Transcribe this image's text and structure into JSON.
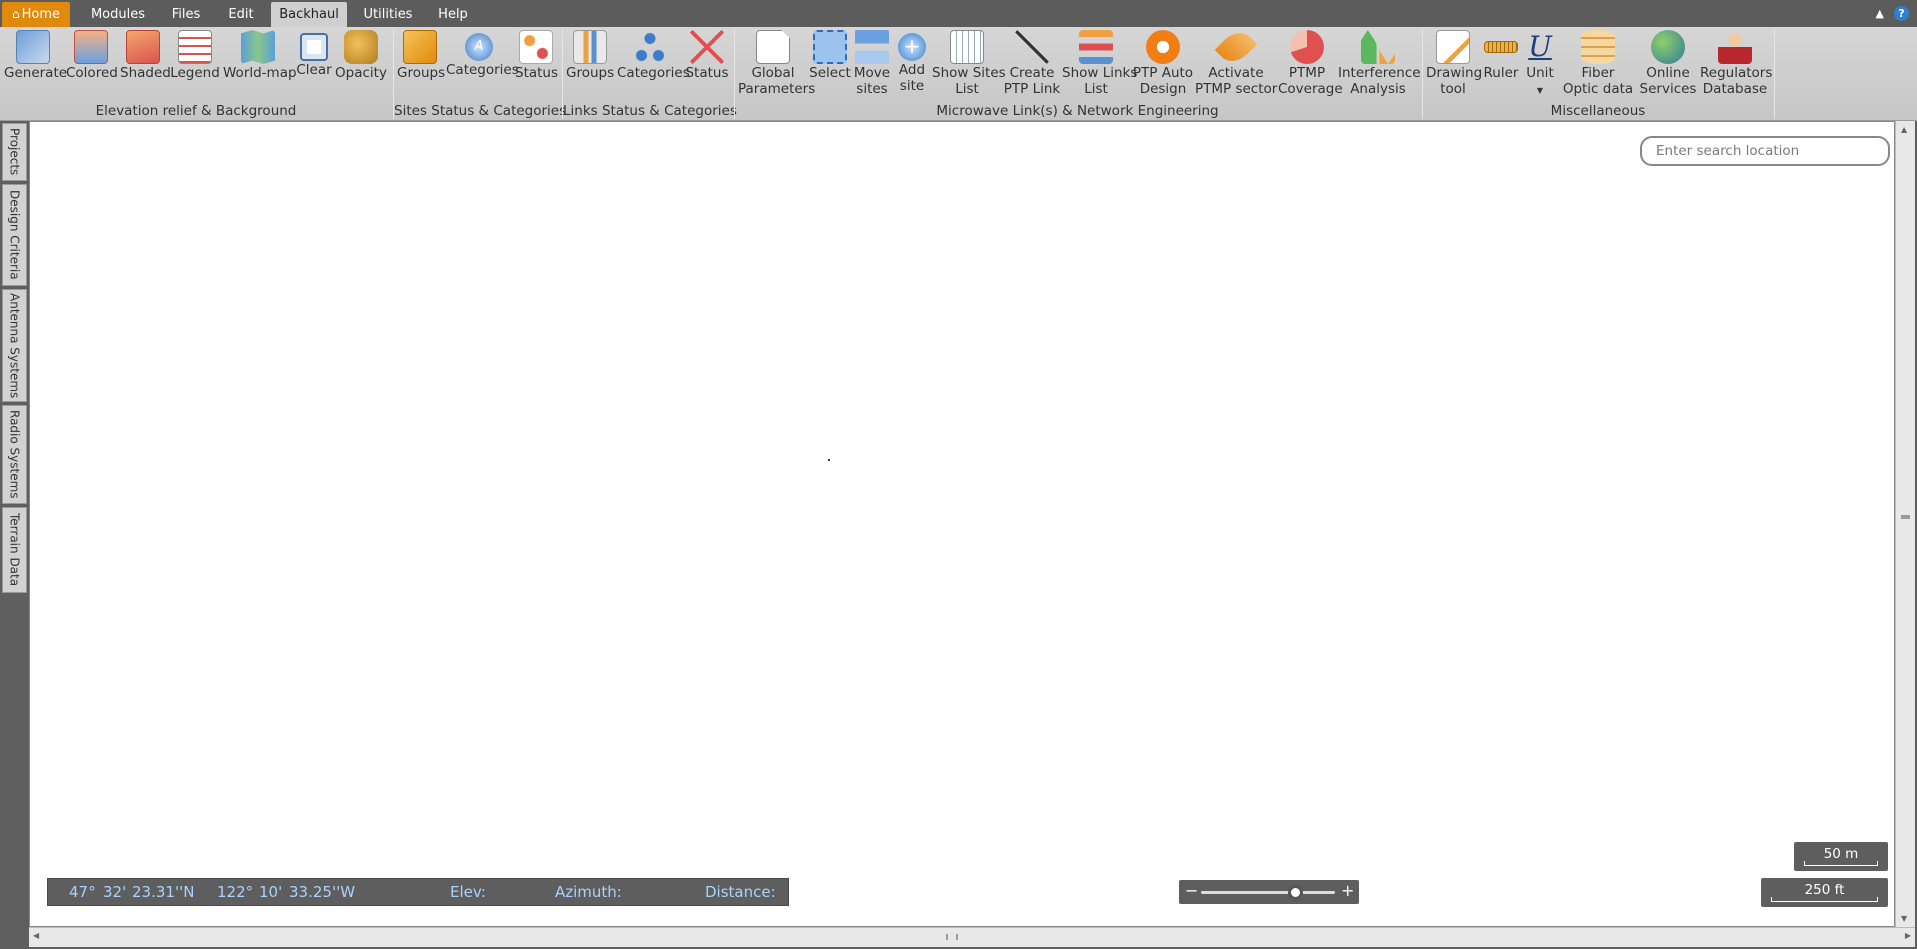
{
  "menubar": {
    "tabs": [
      {
        "label": "Home"
      },
      {
        "label": "Modules"
      },
      {
        "label": "Files"
      },
      {
        "label": "Edit"
      },
      {
        "label": "Backhaul"
      },
      {
        "label": "Utilities"
      },
      {
        "label": "Help"
      }
    ],
    "active_tab": "Backhaul",
    "window_controls": {
      "minimize": "▲",
      "help": "?"
    }
  },
  "ribbon": {
    "groups": [
      {
        "label": "Elevation relief & Background",
        "buttons": [
          "Generate",
          "Colored",
          "Shaded",
          "Legend",
          "World-map",
          "Clear",
          "Opacity"
        ]
      },
      {
        "label": "Sites Status & Categories",
        "buttons": [
          "Groups",
          "Categories",
          "Status"
        ]
      },
      {
        "label": "Links Status & Categories",
        "buttons": [
          "Groups",
          "Categories",
          "Status"
        ]
      },
      {
        "label": "Microwave Link(s) & Network Engineering",
        "buttons": [
          "Global\nParameters",
          "Select",
          "Move\nsites",
          "Add\nsite",
          "Show Sites\nList",
          "Create\nPTP Link",
          "Show Links\nList",
          "PTP Auto\nDesign",
          "Activate\nPTMP sector",
          "PTMP\nCoverage",
          "Interference\nAnalysis"
        ]
      },
      {
        "label": "Miscellaneous",
        "buttons": [
          "Drawing\ntool",
          "Ruler",
          "Unit",
          "Fiber\nOptic data",
          "Online\nServices",
          "Regulators\nDatabase"
        ]
      }
    ]
  },
  "left_rail": {
    "tabs": [
      "Projects",
      "Design Criteria",
      "Antenna Systems",
      "Radio Systems",
      "Terrain Data"
    ]
  },
  "search": {
    "placeholder": "Enter search location"
  },
  "status": {
    "lat_deg": "47°",
    "lat_min": "32'",
    "lat_sec": "23.31''N",
    "lon_deg": "122°",
    "lon_min": "10'",
    "lon_sec": "33.25''W",
    "elev_label": "Elev:",
    "azimuth_label": "Azimuth:",
    "distance_label": "Distance:"
  },
  "zoom": {
    "minus": "−",
    "plus": "+",
    "level": 0.7
  },
  "scale": {
    "metric": "50 m",
    "imperial": "250 ft"
  },
  "colors": {
    "home_tab": "#e08a0c",
    "coords_text": "#a9d2ff",
    "toolbar_bg": "#d0d0d0"
  }
}
